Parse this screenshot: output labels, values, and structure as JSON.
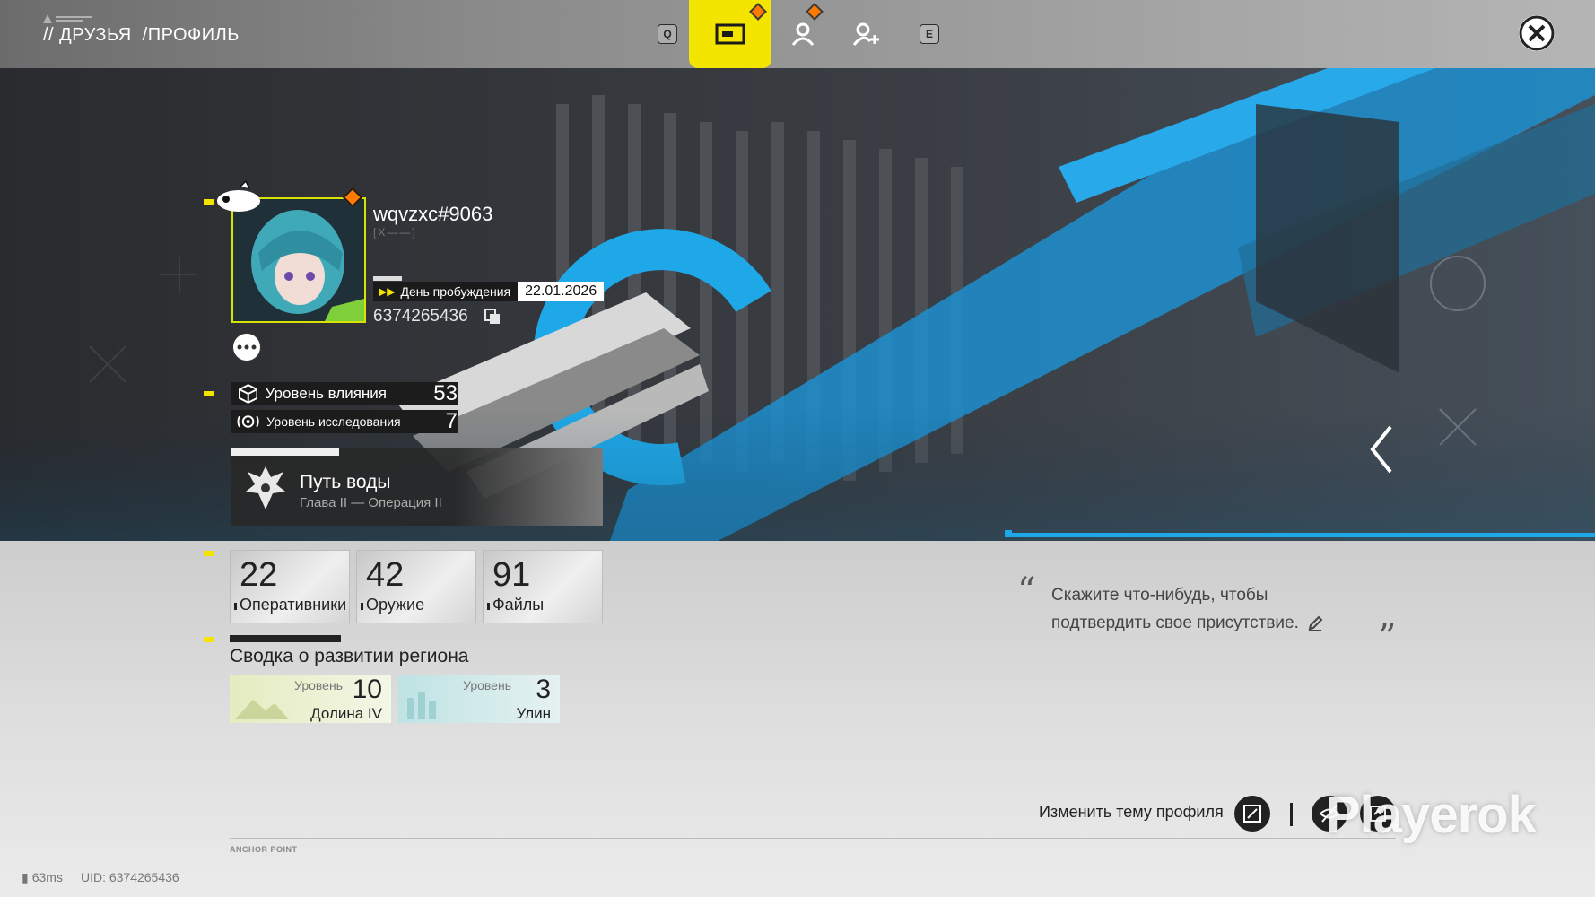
{
  "breadcrumb": {
    "part1": "// ДРУЗЬЯ",
    "part2": "/ПРОФИЛЬ"
  },
  "tabs": {
    "key_left": "Q",
    "key_right": "E"
  },
  "profile": {
    "username": "wqvzxc#9063",
    "tag": "[X——]",
    "awakening_label": "День пробуждения",
    "awakening_date": "22.01.2026",
    "uid": "6374265436"
  },
  "levels": {
    "influence_label": "Уровень влияния",
    "influence_value": "53",
    "research_label": "Уровень исследования",
    "research_value": "7"
  },
  "mission": {
    "title": "Путь воды",
    "subtitle": "Глава II — Операция II"
  },
  "stats": [
    {
      "value": "22",
      "label": "Оперативники"
    },
    {
      "value": "42",
      "label": "Оружие"
    },
    {
      "value": "91",
      "label": "Файлы"
    }
  ],
  "region": {
    "title": "Сводка о развитии региона",
    "cards": [
      {
        "level_label": "Уровень",
        "level": "10",
        "name": "Долина IV"
      },
      {
        "level_label": "Уровень",
        "level": "3",
        "name": "Улин"
      }
    ]
  },
  "quote": {
    "text": "Скажите что-нибудь, чтобы подтвердить свое присутствие.",
    "open_mark": "“",
    "close_mark": "”"
  },
  "footer": {
    "change_theme": "Изменить тему профиля",
    "anchor": "ANCHOR POINT",
    "ping": "63ms",
    "uid_line": "UID: 6374265436",
    "watermark": "Playerok"
  },
  "colors": {
    "accent_yellow": "#f3e500",
    "accent_blue": "#1fa8e8",
    "notif_orange": "#ff7a00"
  }
}
